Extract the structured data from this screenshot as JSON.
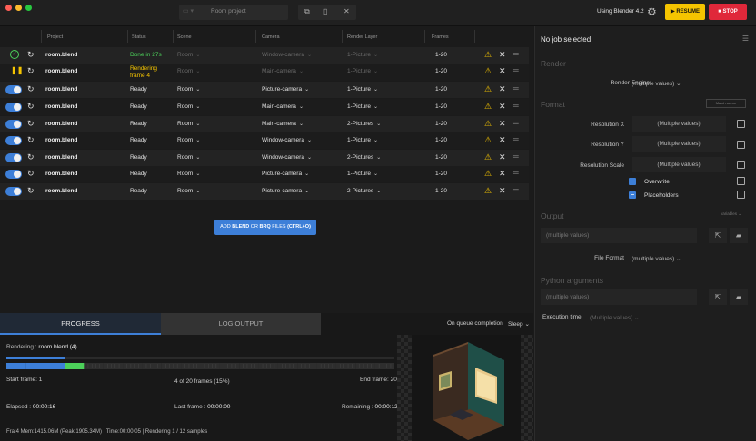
{
  "titlebar": {
    "project_name": "Room project",
    "blender_version": "Using Blender 4.2",
    "resume_label": "RESUME",
    "stop_label": "STOP"
  },
  "table": {
    "headers": [
      "Project",
      "Status",
      "Scene",
      "Camera",
      "Render Layer",
      "Frames"
    ],
    "rows": [
      {
        "state": "done",
        "file": "room.blend",
        "status": "Done in 27s",
        "scene": "Room",
        "camera": "Window-camera",
        "layer": "1-Picture",
        "frames": "1-20"
      },
      {
        "state": "rendering",
        "file": "room.blend",
        "status": "Rendering frame 4",
        "scene": "Room",
        "camera": "Main-camera",
        "layer": "1-Picture",
        "frames": "1-20"
      },
      {
        "state": "ready",
        "file": "room.blend",
        "status": "Ready",
        "scene": "Room",
        "camera": "Picture-camera",
        "layer": "1-Picture",
        "frames": "1-20"
      },
      {
        "state": "ready",
        "file": "room.blend",
        "status": "Ready",
        "scene": "Room",
        "camera": "Main-camera",
        "layer": "1-Picture",
        "frames": "1-20"
      },
      {
        "state": "ready",
        "file": "room.blend",
        "status": "Ready",
        "scene": "Room",
        "camera": "Main-camera",
        "layer": "2-Pictures",
        "frames": "1-20"
      },
      {
        "state": "ready",
        "file": "room.blend",
        "status": "Ready",
        "scene": "Room",
        "camera": "Window-camera",
        "layer": "1-Picture",
        "frames": "1-20"
      },
      {
        "state": "ready",
        "file": "room.blend",
        "status": "Ready",
        "scene": "Room",
        "camera": "Window-camera",
        "layer": "2-Pictures",
        "frames": "1-20"
      },
      {
        "state": "ready",
        "file": "room.blend",
        "status": "Ready",
        "scene": "Room",
        "camera": "Picture-camera",
        "layer": "1-Picture",
        "frames": "1-20"
      },
      {
        "state": "ready",
        "file": "room.blend",
        "status": "Ready",
        "scene": "Room",
        "camera": "Picture-camera",
        "layer": "2-Pictures",
        "frames": "1-20"
      }
    ],
    "add_button": {
      "prefix": "ADD ",
      "blend": "BLEND",
      "or": " OR ",
      "brq": "BRQ",
      "suffix": " FILES ",
      "shortcut": "(CTRL+O)"
    }
  },
  "right_panel": {
    "title": "No job selected",
    "render_section": "Render",
    "render_engine_label": "Render Engine",
    "render_engine_value": "(multiple values)",
    "format_section": "Format",
    "match_scene_label": "Match scene",
    "res_x_label": "Resolution X",
    "res_x_value": "(Multiple values)",
    "res_y_label": "Resolution Y",
    "res_y_value": "(Multiple values)",
    "res_scale_label": "Resolution Scale",
    "res_scale_value": "(Multiple values)",
    "overwrite_label": "Overwrite",
    "placeholders_label": "Placeholders",
    "output_section": "Output",
    "output_menu": "variables",
    "output_path": "(multiple values)",
    "file_format_label": "File Format",
    "file_format_value": "(multiple values)",
    "python_section": "Python arguments",
    "python_path": "(multiple values)",
    "exec_time_label": "Execution time:",
    "exec_time_value": "(Multiple values)"
  },
  "bottom": {
    "tab_progress": "PROGRESS",
    "tab_log": "LOG OUTPUT",
    "queue_label": "On queue completion",
    "queue_value": "Sleep",
    "rendering_label": "Rendering : ",
    "rendering_file": "room.blend (4)",
    "progress_fraction": 0.15,
    "frames_total": 20,
    "frames_done": 3,
    "frame_current": 4,
    "start_frame": "Start frame: 1",
    "frames_count": "4 of 20 frames (15%)",
    "end_frame": "End frame: 20",
    "elapsed_label": "Elapsed : ",
    "elapsed_value": "00:00:16",
    "last_frame_label": "Last frame : ",
    "last_frame_value": "00:00:00",
    "remaining_label": "Remaining : ",
    "remaining_value": "00:00:12",
    "status_line": "Fra:4 Mem:1415.06M (Peak 1905.34M) | Time:00:00.05 | Rendering 1 / 12 samples"
  },
  "colors": {
    "accent": "#3d7fd8",
    "done": "#4cd05a",
    "rendering": "#f5c400",
    "stop": "#e0283a"
  },
  "icons": {
    "done": "check-circle-icon",
    "rendering": "pause-icon",
    "ready": "toggle-switch",
    "reload": "reload-icon",
    "warning": "warning-icon",
    "remove": "close-icon",
    "drag": "drag-handle-icon"
  }
}
